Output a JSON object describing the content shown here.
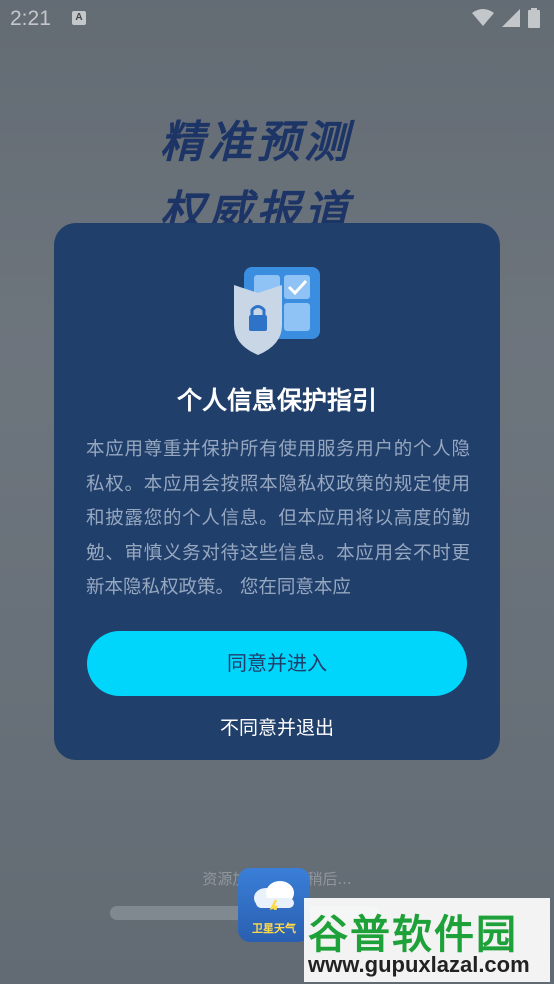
{
  "status_bar": {
    "time": "2:21"
  },
  "background": {
    "slogan_line1": "精准预测",
    "slogan_line2": "权威报道",
    "loading_text": "资源加载中，请稍后...",
    "app_name": "卫星天气"
  },
  "watermark": {
    "title": "谷普软件园",
    "url": "www.gupuxlazal.com"
  },
  "dialog": {
    "title": "个人信息保护指引",
    "body": "本应用尊重并保护所有使用服务用户的个人隐私权。本应用会按照本隐私权政策的规定使用和披露您的个人信息。但本应用将以高度的勤勉、审慎义务对待这些信息。本应用会不时更新本隐私权政策。 您在同意本应",
    "agree_label": "同意并进入",
    "disagree_label": "不同意并退出"
  },
  "colors": {
    "dialog_bg": "#213f6b",
    "agree_button": "#00d5fc",
    "slogan": "#1f3d7a"
  }
}
